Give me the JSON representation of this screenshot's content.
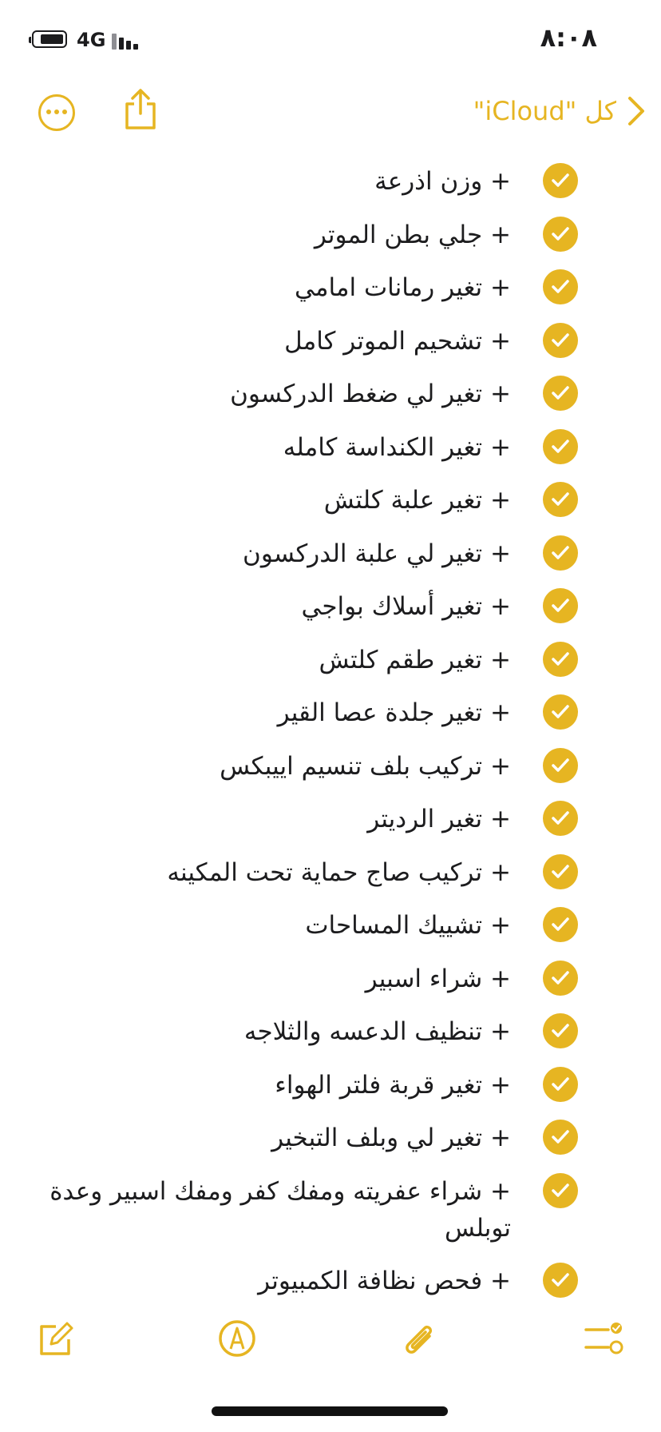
{
  "status": {
    "network": "4G",
    "time": "٨:٠٨"
  },
  "nav": {
    "back_label": "كل \"iCloud\""
  },
  "checklist": [
    {
      "text": "+ وزن اذرعة",
      "checked": true
    },
    {
      "text": "+ جلي بطن الموتر",
      "checked": true
    },
    {
      "text": "+ تغير رمانات امامي",
      "checked": true
    },
    {
      "text": "+ تشحيم الموتر كامل",
      "checked": true
    },
    {
      "text": "+ تغير لي ضغط الدركسون",
      "checked": true
    },
    {
      "text": "+ تغير الكنداسة كامله",
      "checked": true
    },
    {
      "text": "+ تغير علبة كلتش",
      "checked": true
    },
    {
      "text": "+ تغير لي علبة الدركسون",
      "checked": true
    },
    {
      "text": "+ تغير أسلاك بواجي",
      "checked": true
    },
    {
      "text": "+ تغير طقم كلتش",
      "checked": true
    },
    {
      "text": "+ تغير جلدة عصا القير",
      "checked": true
    },
    {
      "text": "+ تركيب بلف تنسيم اييبكس",
      "checked": true
    },
    {
      "text": "+ تغير الرديتر",
      "checked": true
    },
    {
      "text": "+ تركيب صاج حماية تحت المكينه",
      "checked": true
    },
    {
      "text": "+ تشييك المساحات",
      "checked": true
    },
    {
      "text": "+ شراء اسبير",
      "checked": true
    },
    {
      "text": "+ تنظيف الدعسه والثلاجه",
      "checked": true
    },
    {
      "text": "+ تغير قربة فلتر الهواء",
      "checked": true
    },
    {
      "text": "+ تغير لي وبلف التبخير",
      "checked": true
    },
    {
      "text": "+ شراء عفريته ومفك كفر ومفك اسبير وعدة توبلس",
      "checked": true
    },
    {
      "text": "+ فحص نظافة الكمبيوتر",
      "checked": true
    }
  ],
  "colors": {
    "accent": "#e6b522",
    "text": "#1c1c1e",
    "background": "#ffffff"
  },
  "icons": {
    "more": "ellipsis-circle-icon",
    "share": "share-icon",
    "back": "chevron-right-icon",
    "compose": "compose-icon",
    "markup": "markup-pen-icon",
    "attach": "paperclip-icon",
    "checklist": "checklist-icon"
  }
}
